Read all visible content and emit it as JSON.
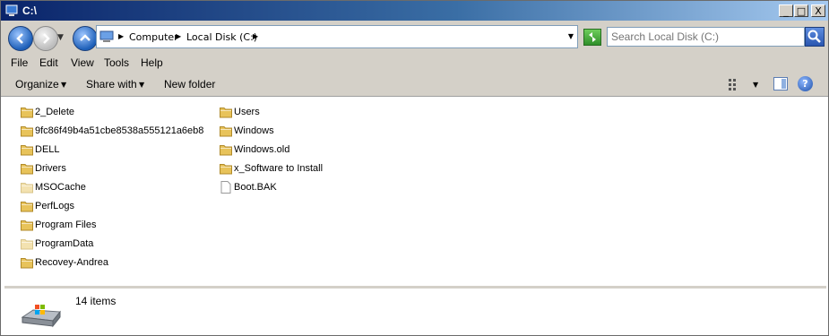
{
  "window": {
    "title": "C:\\"
  },
  "title_buttons": {
    "minimize": "_",
    "maximize": "□",
    "close": "X"
  },
  "address": {
    "crumbs": [
      "Computer",
      "Local Disk (C:)"
    ]
  },
  "search": {
    "placeholder": "Search Local Disk (C:)"
  },
  "menu": {
    "items": [
      "File",
      "Edit",
      "View",
      "Tools",
      "Help"
    ]
  },
  "toolbar": {
    "organize": "Organize",
    "share_with": "Share with",
    "new_folder": "New folder",
    "help": "?"
  },
  "files": [
    {
      "name": "2_Delete",
      "type": "folder"
    },
    {
      "name": "9fc86f49b4a51cbe8538a555121a6eb8",
      "type": "folder"
    },
    {
      "name": "DELL",
      "type": "folder"
    },
    {
      "name": "Drivers",
      "type": "folder"
    },
    {
      "name": "MSOCache",
      "type": "folder-hidden"
    },
    {
      "name": "PerfLogs",
      "type": "folder"
    },
    {
      "name": "Program Files",
      "type": "folder"
    },
    {
      "name": "ProgramData",
      "type": "folder-hidden"
    },
    {
      "name": "Recovey-Andrea",
      "type": "folder"
    },
    {
      "name": "Users",
      "type": "folder"
    },
    {
      "name": "Windows",
      "type": "folder"
    },
    {
      "name": "Windows.old",
      "type": "folder"
    },
    {
      "name": "x_Software to Install",
      "type": "folder"
    },
    {
      "name": "Boot.BAK",
      "type": "file"
    }
  ],
  "details": {
    "count": "14 items"
  },
  "colors": {
    "folder": "#e8c35a",
    "title_start": "#0a246a",
    "title_end": "#a6caf0"
  }
}
